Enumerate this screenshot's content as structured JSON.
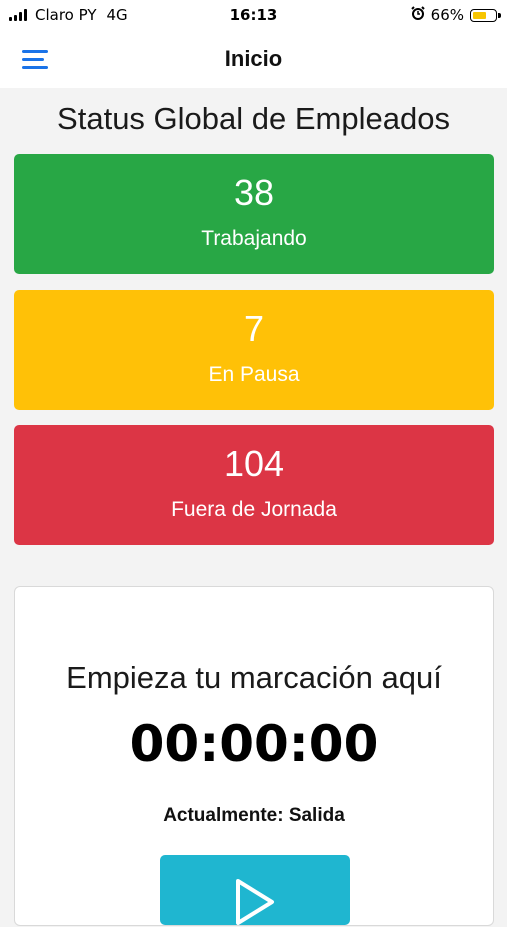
{
  "status_bar": {
    "carrier": "Claro PY",
    "network": "4G",
    "time": "16:13",
    "battery_percent": "66%",
    "battery_level": 0.66,
    "icons": [
      "signal-icon",
      "alarm-icon",
      "battery-icon"
    ]
  },
  "header": {
    "title": "Inicio",
    "menu_icon": "menu-icon"
  },
  "main": {
    "section_title": "Status Global de Empleados",
    "cards": [
      {
        "count": "38",
        "label": "Trabajando",
        "color": "#28a745"
      },
      {
        "count": "7",
        "label": "En Pausa",
        "color": "#ffc107"
      },
      {
        "count": "104",
        "label": "Fuera de Jornada",
        "color": "#dc3545"
      }
    ]
  },
  "clock_panel": {
    "title": "Empieza tu marcación aquí",
    "timer": "00:00:00",
    "status_text": "Actualmente: Salida",
    "action_icon": "play-icon",
    "button_color": "#1fb6d0"
  },
  "colors": {
    "accent": "#1a73e8"
  }
}
